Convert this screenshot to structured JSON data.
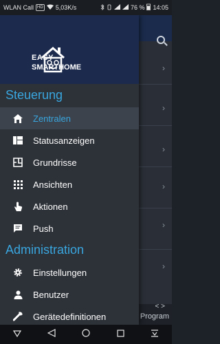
{
  "status_bar": {
    "carrier": "WLAN Call",
    "volte": "HD",
    "speed": "5,03K/s",
    "battery": "76 %",
    "time": "14:05"
  },
  "background_app": {
    "program_label": "Program",
    "arrows": "< >"
  },
  "drawer": {
    "logo_line1": "EASY",
    "logo_line2": "SMARTHOME",
    "sections": [
      {
        "title": "Steuerung",
        "items": [
          {
            "label": "Zentralen",
            "icon": "home-icon",
            "active": true
          },
          {
            "label": "Statusanzeigen",
            "icon": "dashboard-icon"
          },
          {
            "label": "Grundrisse",
            "icon": "floorplan-icon"
          },
          {
            "label": "Ansichten",
            "icon": "grid-icon"
          },
          {
            "label": "Aktionen",
            "icon": "touch-icon"
          },
          {
            "label": "Push",
            "icon": "message-icon"
          }
        ]
      },
      {
        "title": "Administration",
        "items": [
          {
            "label": "Einstellungen",
            "icon": "gear-icon"
          },
          {
            "label": "Benutzer",
            "icon": "person-icon"
          },
          {
            "label": "Gerätedefinitionen",
            "icon": "wrench-icon"
          }
        ]
      }
    ]
  },
  "colors": {
    "accent": "#39a6df",
    "drawer_bg": "#2d3138",
    "header_bg": "#1c2b4d",
    "active_bg": "#3c434c"
  }
}
